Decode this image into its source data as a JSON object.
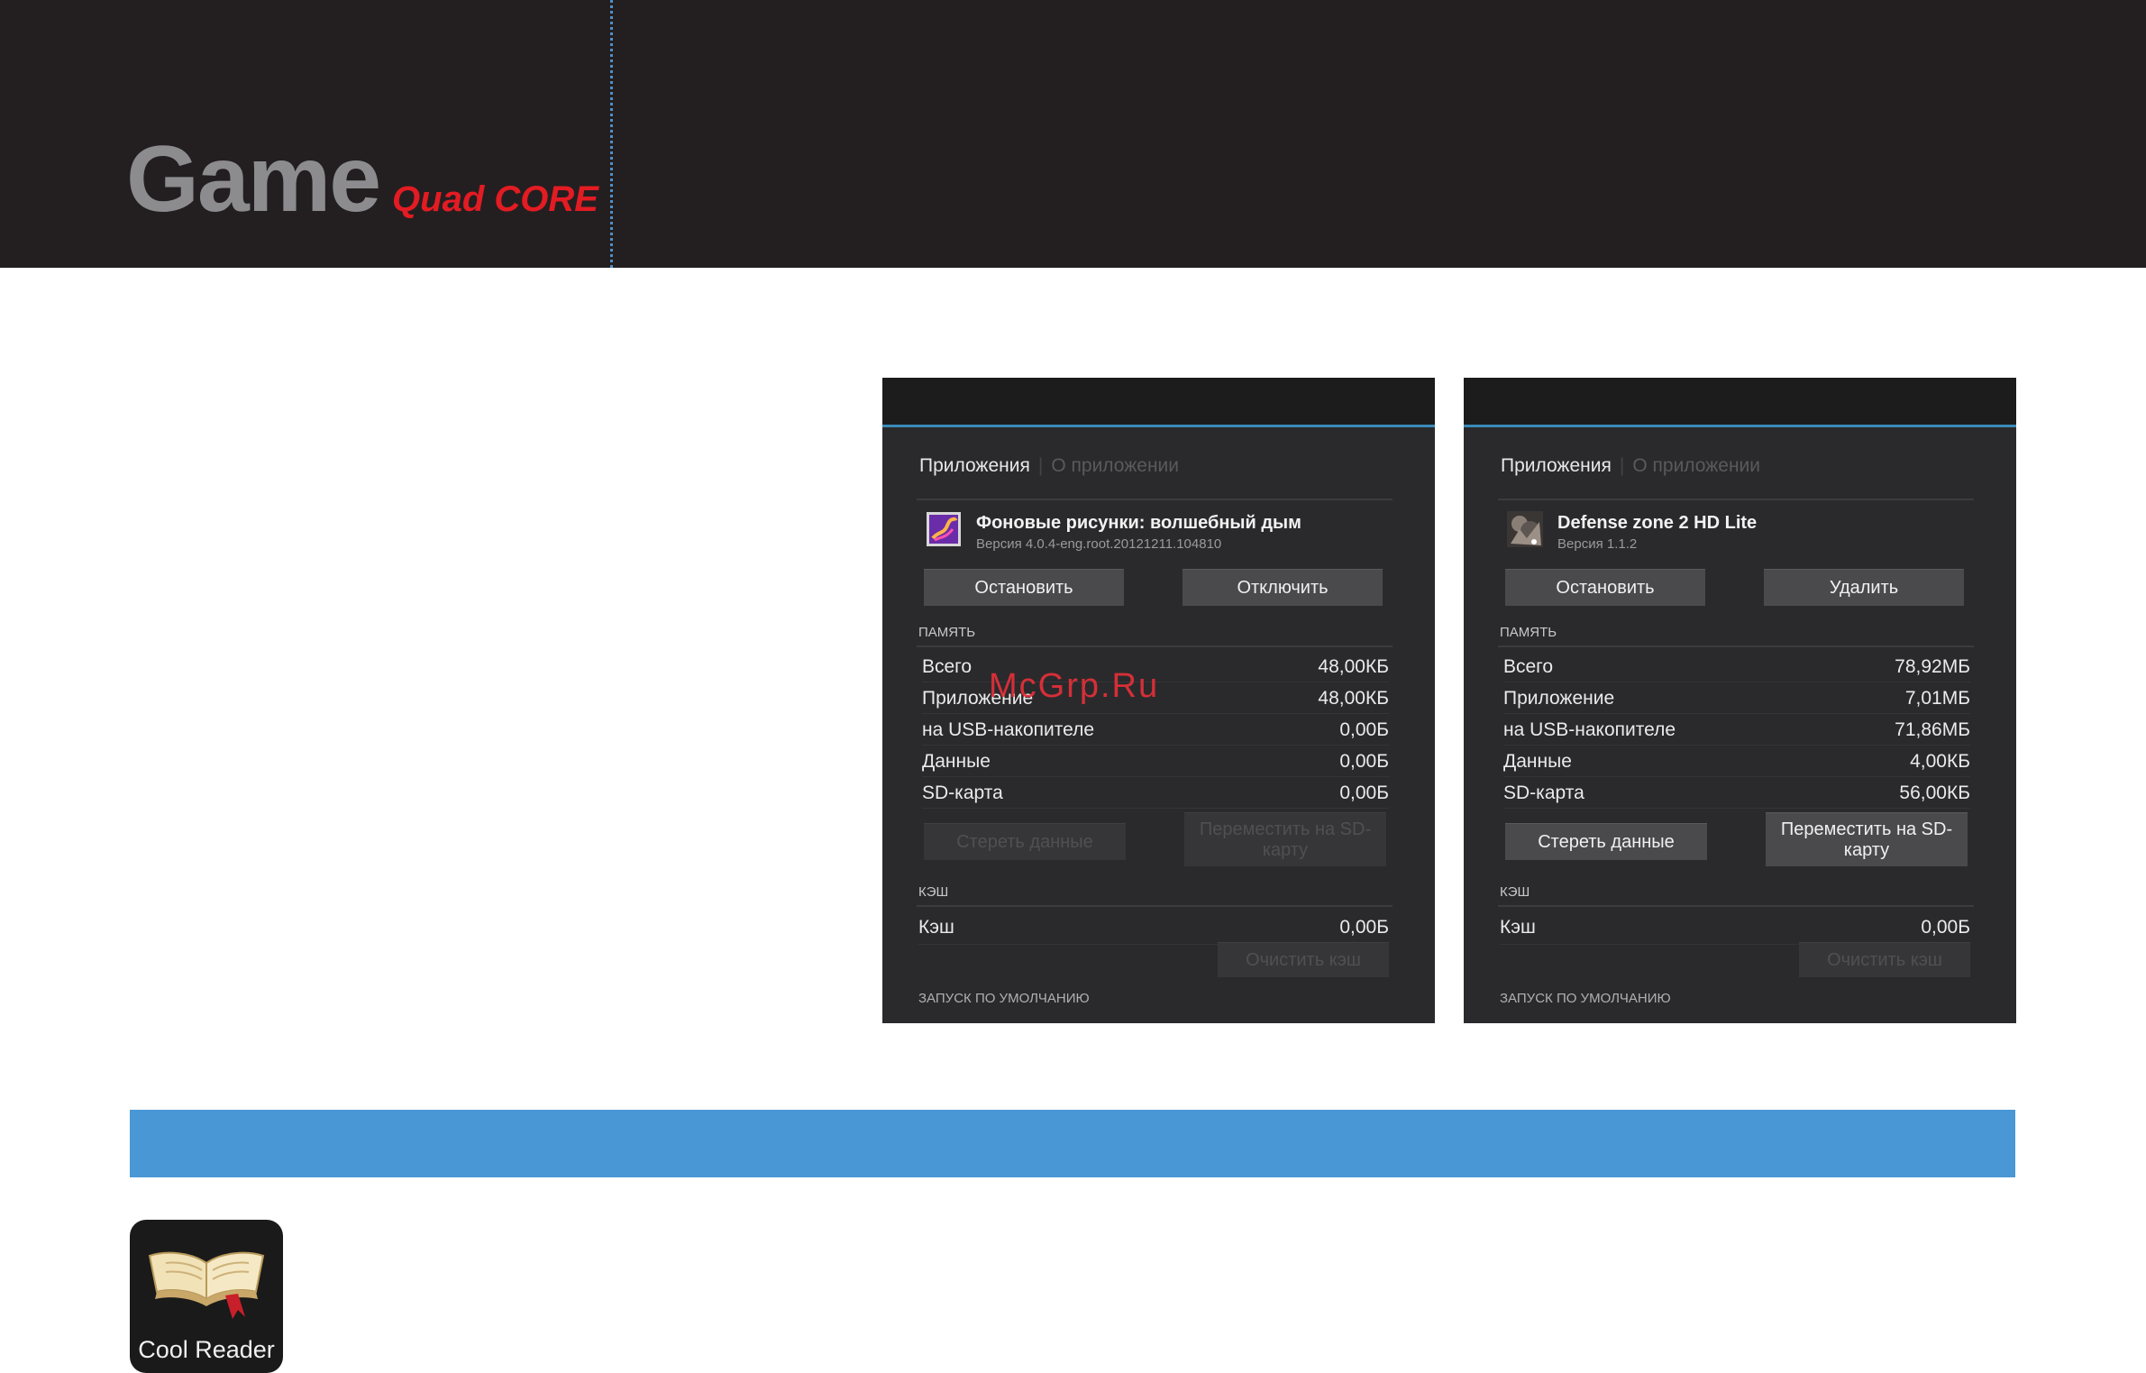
{
  "header": {
    "brand": "Game",
    "sub": "Quad CORE"
  },
  "watermark": "McGrp.Ru",
  "screens": [
    {
      "crumb_active": "Приложения",
      "crumb_inactive": "О приложении",
      "app_name": "Фоновые рисунки: волшебный дым",
      "app_version": "Версия 4.0.4-eng.root.20121211.104810",
      "btn_left": "Остановить",
      "btn_right": "Отключить",
      "memory_header": "ПАМЯТЬ",
      "rows": [
        {
          "label": "Всего",
          "value": "48,00КБ"
        },
        {
          "label": "Приложение",
          "value": "48,00КБ"
        },
        {
          "label": "на USB-накопителе",
          "value": "0,00Б"
        },
        {
          "label": "Данные",
          "value": "0,00Б"
        },
        {
          "label": "SD-карта",
          "value": "0,00Б"
        }
      ],
      "clear_data": "Стереть данные",
      "move_sd": "Переместить на SD-карту",
      "cache_header": "КЭШ",
      "cache_label": "Кэш",
      "cache_value": "0,00Б",
      "clear_cache": "Очистить кэш",
      "launch_header": "ЗАПУСК ПО УМОЛЧАНИЮ"
    },
    {
      "crumb_active": "Приложения",
      "crumb_inactive": "О приложении",
      "app_name": "Defense zone 2 HD Lite",
      "app_version": "Версия 1.1.2",
      "btn_left": "Остановить",
      "btn_right": "Удалить",
      "memory_header": "ПАМЯТЬ",
      "rows": [
        {
          "label": "Всего",
          "value": "78,92МБ"
        },
        {
          "label": "Приложение",
          "value": "7,01МБ"
        },
        {
          "label": "на USB-накопителе",
          "value": "71,86МБ"
        },
        {
          "label": "Данные",
          "value": "4,00КБ"
        },
        {
          "label": "SD-карта",
          "value": "56,00КБ"
        }
      ],
      "clear_data": "Стереть данные",
      "move_sd": "Переместить на SD-карту",
      "cache_header": "КЭШ",
      "cache_label": "Кэш",
      "cache_value": "0,00Б",
      "clear_cache": "Очистить кэш",
      "launch_header": "ЗАПУСК ПО УМОЛЧАНИЮ"
    }
  ],
  "cool_reader": {
    "label": "Cool Reader",
    "icon": "book-icon"
  }
}
